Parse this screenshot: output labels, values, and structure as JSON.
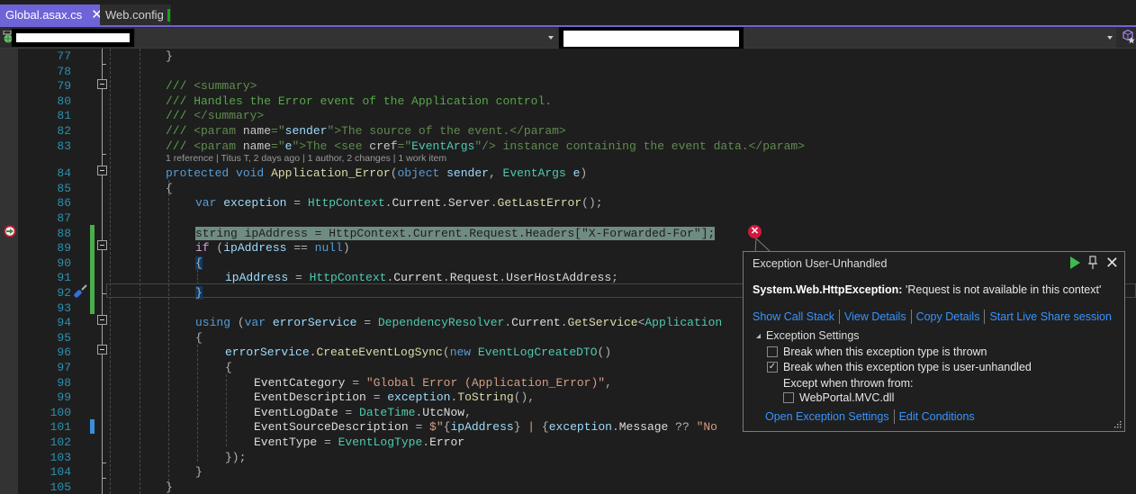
{
  "tabs": [
    {
      "label": "Global.asax.cs",
      "active": true,
      "modified": true,
      "close_icon": "close-icon"
    },
    {
      "label": "Web.config",
      "active": false,
      "modified": true
    }
  ],
  "navbar": {
    "left_icon": "project-globe-icon",
    "right_icon": "solution-explorer-icon",
    "project_combo_value": "[redacted]",
    "member_combo_value": "[redacted]"
  },
  "codelens": "1 reference | Titus T, 2 days ago | 1 author, 2 changes | 1 work item",
  "lines": [
    {
      "num": "77"
    },
    {
      "num": "78"
    },
    {
      "num": "79"
    },
    {
      "num": "80"
    },
    {
      "num": "81"
    },
    {
      "num": "82"
    },
    {
      "num": "83"
    },
    {
      "num": "84"
    },
    {
      "num": "85"
    },
    {
      "num": "86"
    },
    {
      "num": "87"
    },
    {
      "num": "88"
    },
    {
      "num": "89"
    },
    {
      "num": "90"
    },
    {
      "num": "91"
    },
    {
      "num": "92"
    },
    {
      "num": "93"
    },
    {
      "num": "94"
    },
    {
      "num": "95"
    },
    {
      "num": "96"
    },
    {
      "num": "97"
    },
    {
      "num": "98"
    },
    {
      "num": "99"
    },
    {
      "num": "100"
    },
    {
      "num": "101"
    },
    {
      "num": "102"
    },
    {
      "num": "103"
    },
    {
      "num": "104"
    },
    {
      "num": "105"
    }
  ],
  "code": {
    "l77": "}",
    "l79": [
      "///",
      " <summary>"
    ],
    "l80": [
      "///",
      " Handles the Error event of the Application control."
    ],
    "l81": [
      "///",
      " </summary>"
    ],
    "l82": [
      "///",
      " <param ",
      "name",
      "=\"",
      "sender",
      "\"",
      ">The source of the event.</param>"
    ],
    "l83": [
      "///",
      " <param ",
      "name",
      "=\"",
      "e",
      "\"",
      ">The <see ",
      "cref",
      "=\"",
      "EventArgs",
      "\"",
      "/> instance containing the event data.</param>"
    ],
    "l84": [
      "protected",
      " ",
      "void",
      " ",
      "Application_Error",
      "(",
      "object",
      " ",
      "sender",
      ", ",
      "EventArgs",
      " ",
      "e",
      ")"
    ],
    "l85": "{",
    "l86": [
      "var",
      " ",
      "exception",
      " = ",
      "HttpContext",
      ".",
      "Current",
      ".",
      "Server",
      ".",
      "GetLastError",
      "();"
    ],
    "l88": "string ipAddress = HttpContext.Current.Request.Headers[\"X-Forwarded-For\"];",
    "l89": [
      "if",
      " (",
      "ipAddress",
      " == ",
      "null",
      ")"
    ],
    "l90": "{",
    "l91": [
      "ipAddress",
      " = ",
      "HttpContext",
      ".",
      "Current",
      ".",
      "Request",
      ".",
      "UserHostAddress",
      ";"
    ],
    "l92": "}",
    "l94": [
      "using",
      " (",
      "var",
      " ",
      "errorService",
      " = ",
      "DependencyResolver",
      ".",
      "Current",
      ".",
      "GetService",
      "<",
      "Application"
    ],
    "l95": "{",
    "l96": [
      "errorService",
      ".",
      "CreateEventLogSync",
      "(",
      "new",
      " ",
      "EventLogCreateDTO",
      "()"
    ],
    "l97": "{",
    "l98": [
      "EventCategory",
      " = ",
      "\"Global Error (Application_Error)\"",
      ","
    ],
    "l99": [
      "EventDescription",
      " = ",
      "exception",
      ".",
      "ToString",
      "(),"
    ],
    "l100": [
      "EventLogDate",
      " = ",
      "DateTime",
      ".",
      "UtcNow",
      ","
    ],
    "l101": [
      "EventSourceDescription",
      " = ",
      "$\"",
      "{",
      "ipAddress",
      "}",
      " | ",
      "{",
      "exception",
      ".",
      "Message",
      " ?? ",
      "\"No "
    ],
    "l102": [
      "EventType",
      " = ",
      "EventLogType",
      ".",
      "Error"
    ],
    "l103": "});",
    "l104": "}",
    "l105": "}"
  },
  "gutter_icons": {
    "line88": "exception-current-statement-icon",
    "line92": "quick-action-screwdriver-icon"
  },
  "exception_popup": {
    "title": "Exception User-Unhandled",
    "exception_type": "System.Web.HttpException:",
    "exception_message": "'Request is not available in this context'",
    "links": [
      "Show Call Stack",
      "View Details",
      "Copy Details",
      "Start Live Share session"
    ],
    "settings_header": "Exception Settings",
    "options": [
      {
        "label": "Break when this exception type is thrown",
        "checked": false
      },
      {
        "label": "Break when this exception type is user-unhandled",
        "checked": true
      }
    ],
    "except_label": "Except when thrown from:",
    "except_modules": [
      {
        "label": "WebPortal.MVC.dll",
        "checked": false
      }
    ],
    "footer_links": [
      "Open Exception Settings",
      "Edit Conditions"
    ],
    "icons": {
      "continue": "continue-play-icon",
      "pin": "pin-icon",
      "close": "close-icon",
      "error": "error-icon"
    }
  },
  "colors": {
    "accent": "#6e63d8",
    "line_number": "#2b91af",
    "comment": "#57a64a",
    "keyword": "#569cd6",
    "type": "#4ec9b0",
    "method": "#dcdcaa",
    "string": "#d69d85",
    "link": "#3794ff",
    "change_bar": "#4aae4a",
    "error": "#d1193b"
  }
}
